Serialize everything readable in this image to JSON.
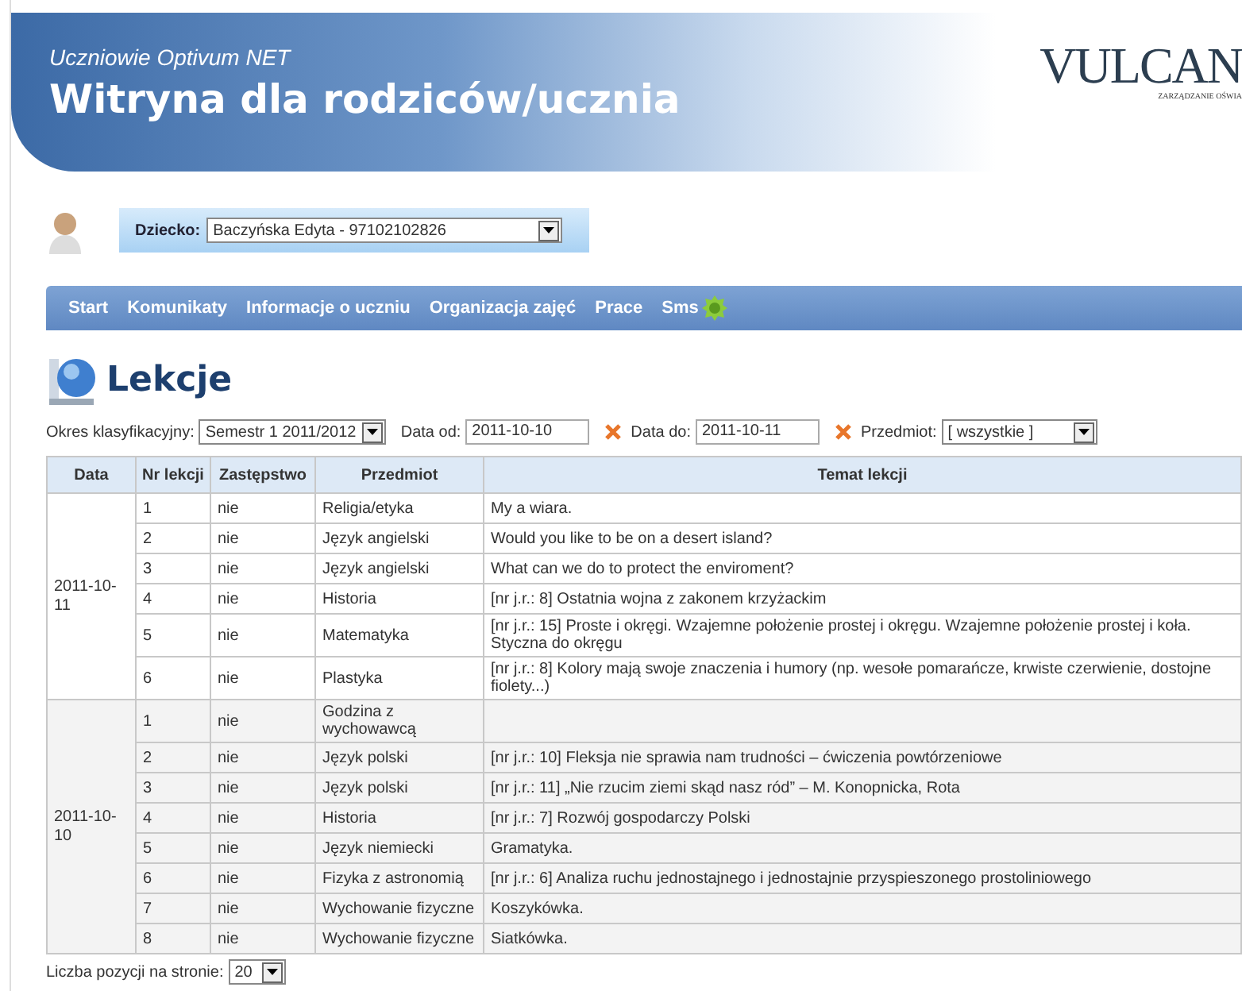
{
  "header": {
    "subtitle": "Uczniowie Optivum NET",
    "title": "Witryna dla rodziców/ucznia",
    "logo": "VULCAN",
    "logo_tagline": "ZARZĄDZANIE OŚWIA"
  },
  "child": {
    "label": "Dziecko:",
    "value": "Baczyńska Edyta - 97102102826"
  },
  "nav": [
    {
      "label": "Start"
    },
    {
      "label": "Komunikaty"
    },
    {
      "label": "Informacje o uczniu"
    },
    {
      "label": "Organizacja zajęć"
    },
    {
      "label": "Prace"
    },
    {
      "label": "Sms"
    }
  ],
  "page_title": "Lekcje",
  "filters": {
    "period_label": "Okres klasyfikacyjny:",
    "period": "Semestr 1 2011/2012",
    "from_label": "Data od:",
    "from": "2011-10-10",
    "to_label": "Data do:",
    "to": "2011-10-11",
    "subject_label": "Przedmiot:",
    "subject": "[ wszystkie ]"
  },
  "table": {
    "columns": [
      "Data",
      "Nr lekcji",
      "Zastępstwo",
      "Przedmiot",
      "Temat lekcji"
    ],
    "groups": [
      {
        "date": "2011-10-11",
        "rows": [
          [
            "1",
            "nie",
            "Religia/etyka",
            "My a wiara."
          ],
          [
            "2",
            "nie",
            "Język angielski",
            "Would you like to be on a desert island?"
          ],
          [
            "3",
            "nie",
            "Język angielski",
            "What can we do to protect the enviroment?"
          ],
          [
            "4",
            "nie",
            "Historia",
            "[nr j.r.: 8] Ostatnia wojna z zakonem krzyżackim"
          ],
          [
            "5",
            "nie",
            "Matematyka",
            "[nr j.r.: 15] Proste i okręgi. Wzajemne położenie prostej i okręgu. Wzajemne położenie prostej i koła. Styczna do okręgu"
          ],
          [
            "6",
            "nie",
            "Plastyka",
            "[nr j.r.: 8] Kolory mają swoje znaczenia i humory (np. wesołe pomarańcze, krwiste czerwienie, dostojne fiolety...)"
          ]
        ]
      },
      {
        "date": "2011-10-10",
        "rows": [
          [
            "1",
            "nie",
            "Godzina z wychowawcą",
            ""
          ],
          [
            "2",
            "nie",
            "Język polski",
            "[nr j.r.: 10] Fleksja nie sprawia nam trudności – ćwiczenia powtórzeniowe"
          ],
          [
            "3",
            "nie",
            "Język polski",
            "[nr j.r.: 11] „Nie rzucim ziemi skąd nasz ród” – M. Konopnicka, Rota"
          ],
          [
            "4",
            "nie",
            "Historia",
            "[nr j.r.: 7] Rozwój gospodarczy Polski"
          ],
          [
            "5",
            "nie",
            "Język niemiecki",
            "Gramatyka."
          ],
          [
            "6",
            "nie",
            "Fizyka z astronomią",
            "[nr j.r.: 6] Analiza ruchu jednostajnego i jednostajnie przyspieszonego prostoliniowego"
          ],
          [
            "7",
            "nie",
            "Wychowanie fizyczne",
            "Koszykówka."
          ],
          [
            "8",
            "nie",
            "Wychowanie fizyczne",
            "Siatkówka."
          ]
        ]
      }
    ]
  },
  "page_size": {
    "label": "Liczba pozycji na stronie:",
    "value": "20"
  }
}
